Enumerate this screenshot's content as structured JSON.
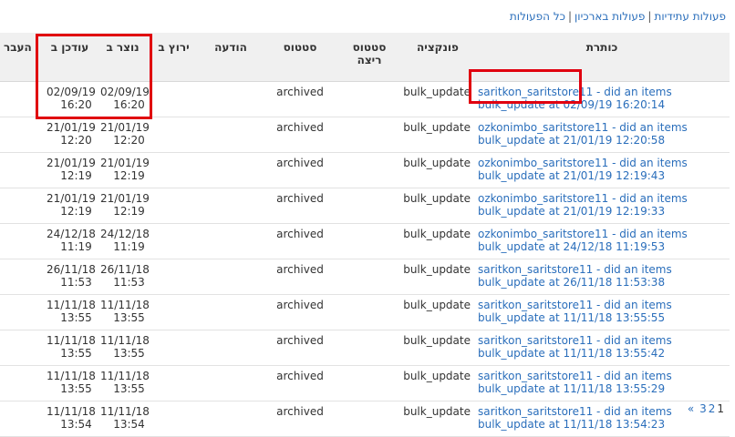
{
  "topnav": {
    "future": "פעולות עתידיות",
    "archived": "פעולות בארכיון",
    "all": "כל הפעולות",
    "sep": "|"
  },
  "columns": {
    "title": "כותרת",
    "function": "פונקציה",
    "run_status": "סטטוס ריצה",
    "status": "סטטוס",
    "message": "הודעה",
    "run_at": "ירוץ ב",
    "created": "נוצר ב",
    "updated": "עודכן ב",
    "passed": "העבר"
  },
  "rows": [
    {
      "title": "saritkon_saritstore11 - did an items bulk_update at 02/09/19 16:20:14",
      "function": "bulk_update",
      "status": "archived",
      "created_d": "02/09/19",
      "created_t": "16:20",
      "updated_d": "02/09/19",
      "updated_t": "16:20"
    },
    {
      "title": "ozkonimbo_saritstore11 - did an items bulk_update at 21/01/19 12:20:58",
      "function": "bulk_update",
      "status": "archived",
      "created_d": "21/01/19",
      "created_t": "12:20",
      "updated_d": "21/01/19",
      "updated_t": "12:20"
    },
    {
      "title": "ozkonimbo_saritstore11 - did an items bulk_update at 21/01/19 12:19:43",
      "function": "bulk_update",
      "status": "archived",
      "created_d": "21/01/19",
      "created_t": "12:19",
      "updated_d": "21/01/19",
      "updated_t": "12:19"
    },
    {
      "title": "ozkonimbo_saritstore11 - did an items bulk_update at 21/01/19 12:19:33",
      "function": "bulk_update",
      "status": "archived",
      "created_d": "21/01/19",
      "created_t": "12:19",
      "updated_d": "21/01/19",
      "updated_t": "12:19"
    },
    {
      "title": "ozkonimbo_saritstore11 - did an items bulk_update at 24/12/18 11:19:53",
      "function": "bulk_update",
      "status": "archived",
      "created_d": "24/12/18",
      "created_t": "11:19",
      "updated_d": "24/12/18",
      "updated_t": "11:19"
    },
    {
      "title": "saritkon_saritstore11 - did an items bulk_update at 26/11/18 11:53:38",
      "function": "bulk_update",
      "status": "archived",
      "created_d": "26/11/18",
      "created_t": "11:53",
      "updated_d": "26/11/18",
      "updated_t": "11:53"
    },
    {
      "title": "saritkon_saritstore11 - did an items bulk_update at 11/11/18 13:55:55",
      "function": "bulk_update",
      "status": "archived",
      "created_d": "11/11/18",
      "created_t": "13:55",
      "updated_d": "11/11/18",
      "updated_t": "13:55"
    },
    {
      "title": "saritkon_saritstore11 - did an items bulk_update at 11/11/18 13:55:42",
      "function": "bulk_update",
      "status": "archived",
      "created_d": "11/11/18",
      "created_t": "13:55",
      "updated_d": "11/11/18",
      "updated_t": "13:55"
    },
    {
      "title": "saritkon_saritstore11 - did an items bulk_update at 11/11/18 13:55:29",
      "function": "bulk_update",
      "status": "archived",
      "created_d": "11/11/18",
      "created_t": "13:55",
      "updated_d": "11/11/18",
      "updated_t": "13:55"
    },
    {
      "title": "saritkon_saritstore11 - did an items bulk_update at 11/11/18 13:54:23",
      "function": "bulk_update",
      "status": "archived",
      "created_d": "11/11/18",
      "created_t": "13:54",
      "updated_d": "11/11/18",
      "updated_t": "13:54"
    }
  ],
  "pager": {
    "prev": "«",
    "pages": [
      "3",
      "2",
      "1"
    ],
    "current": "1"
  },
  "highlight_color": "#e0000f",
  "link_color": "#2a6ebb"
}
